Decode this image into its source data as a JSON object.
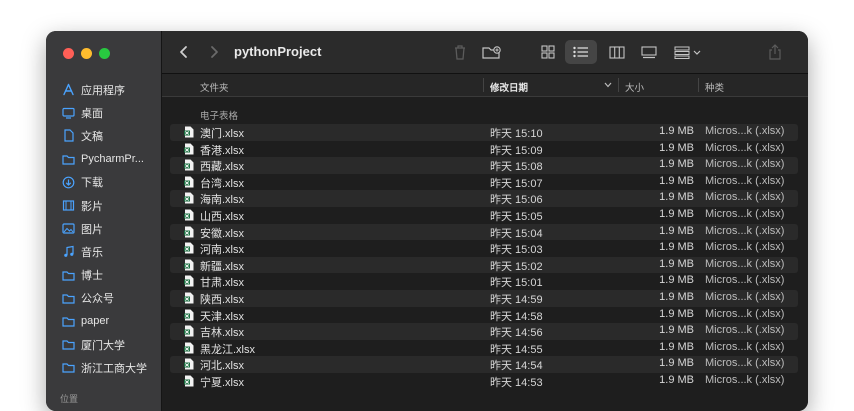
{
  "window": {
    "title": "pythonProject"
  },
  "sidebar": {
    "items": [
      {
        "label": "应用程序",
        "icon": "apps-icon"
      },
      {
        "label": "桌面",
        "icon": "desktop-icon"
      },
      {
        "label": "文稿",
        "icon": "document-icon"
      },
      {
        "label": "PycharmPr...",
        "icon": "folder-icon"
      },
      {
        "label": "下载",
        "icon": "download-icon"
      },
      {
        "label": "影片",
        "icon": "film-icon"
      },
      {
        "label": "图片",
        "icon": "photo-icon"
      },
      {
        "label": "音乐",
        "icon": "music-icon"
      },
      {
        "label": "博士",
        "icon": "folder-icon"
      },
      {
        "label": "公众号",
        "icon": "folder-icon"
      },
      {
        "label": "paper",
        "icon": "folder-icon"
      },
      {
        "label": "厦门大学",
        "icon": "folder-icon"
      },
      {
        "label": "浙江工商大学",
        "icon": "folder-icon"
      }
    ],
    "section_label": "位置"
  },
  "columns": {
    "name": "文件夹",
    "date": "修改日期",
    "size": "大小",
    "kind": "种类"
  },
  "group_label": "电子表格",
  "files": [
    {
      "name": "澳门.xlsx",
      "date": "昨天 15:10",
      "size": "1.9 MB",
      "kind": "Micros...k (.xlsx)"
    },
    {
      "name": "香港.xlsx",
      "date": "昨天 15:09",
      "size": "1.9 MB",
      "kind": "Micros...k (.xlsx)"
    },
    {
      "name": "西藏.xlsx",
      "date": "昨天 15:08",
      "size": "1.9 MB",
      "kind": "Micros...k (.xlsx)"
    },
    {
      "name": "台湾.xlsx",
      "date": "昨天 15:07",
      "size": "1.9 MB",
      "kind": "Micros...k (.xlsx)"
    },
    {
      "name": "海南.xlsx",
      "date": "昨天 15:06",
      "size": "1.9 MB",
      "kind": "Micros...k (.xlsx)"
    },
    {
      "name": "山西.xlsx",
      "date": "昨天 15:05",
      "size": "1.9 MB",
      "kind": "Micros...k (.xlsx)"
    },
    {
      "name": "安徽.xlsx",
      "date": "昨天 15:04",
      "size": "1.9 MB",
      "kind": "Micros...k (.xlsx)"
    },
    {
      "name": "河南.xlsx",
      "date": "昨天 15:03",
      "size": "1.9 MB",
      "kind": "Micros...k (.xlsx)"
    },
    {
      "name": "新疆.xlsx",
      "date": "昨天 15:02",
      "size": "1.9 MB",
      "kind": "Micros...k (.xlsx)"
    },
    {
      "name": "甘肃.xlsx",
      "date": "昨天 15:01",
      "size": "1.9 MB",
      "kind": "Micros...k (.xlsx)"
    },
    {
      "name": "陕西.xlsx",
      "date": "昨天 14:59",
      "size": "1.9 MB",
      "kind": "Micros...k (.xlsx)"
    },
    {
      "name": "天津.xlsx",
      "date": "昨天 14:58",
      "size": "1.9 MB",
      "kind": "Micros...k (.xlsx)"
    },
    {
      "name": "吉林.xlsx",
      "date": "昨天 14:56",
      "size": "1.9 MB",
      "kind": "Micros...k (.xlsx)"
    },
    {
      "name": "黑龙江.xlsx",
      "date": "昨天 14:55",
      "size": "1.9 MB",
      "kind": "Micros...k (.xlsx)"
    },
    {
      "name": "河北.xlsx",
      "date": "昨天 14:54",
      "size": "1.9 MB",
      "kind": "Micros...k (.xlsx)"
    },
    {
      "name": "宁夏.xlsx",
      "date": "昨天 14:53",
      "size": "1.9 MB",
      "kind": "Micros...k (.xlsx)"
    }
  ],
  "colors": {
    "accent": "#0a84ff",
    "excel": "#1d6f42"
  }
}
